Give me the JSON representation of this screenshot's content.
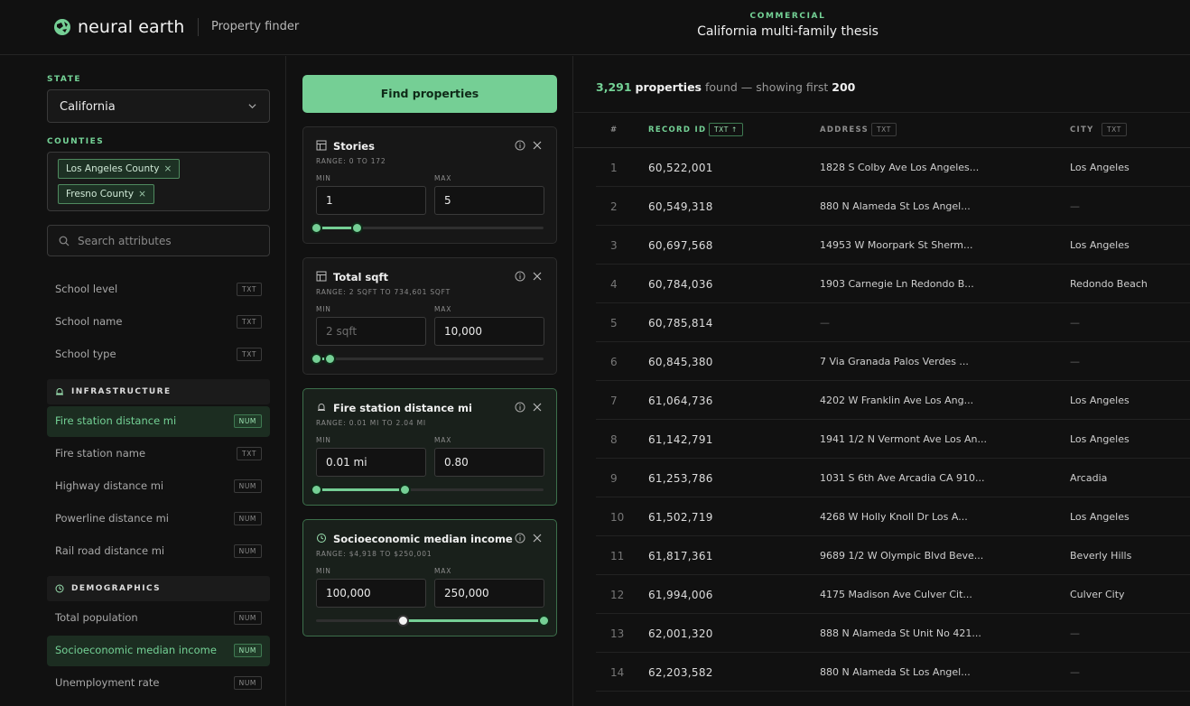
{
  "header": {
    "brand": "neural earth",
    "subtitle": "Property finder",
    "kicker": "COMMERCIAL",
    "title": "California multi-family thesis"
  },
  "sidebar": {
    "state_label": "STATE",
    "state_value": "California",
    "counties_label": "COUNTIES",
    "counties": [
      "Los Angeles County",
      "Fresno County"
    ],
    "search_placeholder": "Search attributes",
    "attributes_top": [
      {
        "name": "School level",
        "type": "TXT"
      },
      {
        "name": "School name",
        "type": "TXT"
      },
      {
        "name": "School type",
        "type": "TXT"
      }
    ],
    "infrastructure": {
      "label": "INFRASTRUCTURE",
      "items": [
        {
          "name": "Fire station distance mi",
          "type": "NUM",
          "active": true
        },
        {
          "name": "Fire station name",
          "type": "TXT"
        },
        {
          "name": "Highway distance mi",
          "type": "NUM"
        },
        {
          "name": "Powerline distance mi",
          "type": "NUM"
        },
        {
          "name": "Rail road distance mi",
          "type": "NUM"
        }
      ]
    },
    "demographics": {
      "label": "DEMOGRAPHICS",
      "items": [
        {
          "name": "Total population",
          "type": "NUM"
        },
        {
          "name": "Socioeconomic median income",
          "type": "NUM",
          "active": true
        },
        {
          "name": "Unemployment rate",
          "type": "NUM"
        }
      ]
    }
  },
  "filters": {
    "find_label": "Find properties",
    "min_label": "MIN",
    "max_label": "MAX",
    "cards": [
      {
        "title": "Stories",
        "range": "RANGE: 0 TO 172",
        "min": "1",
        "max": "5",
        "min_placeholder": false,
        "slider_from": 0,
        "slider_to": 0.18,
        "active": false,
        "icon": "table-icon"
      },
      {
        "title": "Total sqft",
        "range": "RANGE: 2 SQFT TO 734,601 SQFT",
        "min": "2 sqft",
        "max": "10,000",
        "min_placeholder": true,
        "slider_from": 0,
        "slider_to": 0.06,
        "active": false,
        "icon": "table-icon"
      },
      {
        "title": "Fire station distance mi",
        "range": "RANGE: 0.01 MI TO 2.04 MI",
        "min": "0.01 mi",
        "max": "0.80",
        "min_placeholder": false,
        "slider_from": 0,
        "slider_to": 0.39,
        "active": true,
        "icon": "bell-icon"
      },
      {
        "title": "Socioeconomic median income",
        "range": "RANGE: $4,918 TO $250,001",
        "min": "100,000",
        "max": "250,000",
        "min_placeholder": false,
        "slider_from": 0.38,
        "slider_to": 1,
        "active": true,
        "icon": "clock-icon"
      }
    ]
  },
  "results": {
    "count": "3,291",
    "count_suffix": "properties",
    "found_text": "found — showing first",
    "shown": "200",
    "columns": {
      "index": "#",
      "record_id": "RECORD ID",
      "record_tag": "TXT ↑",
      "address": "ADDRESS",
      "address_tag": "TXT",
      "city": "CITY",
      "city_tag": "TXT"
    },
    "rows": [
      {
        "i": "1",
        "id": "60,522,001",
        "addr": "1828 S Colby Ave Los Angeles...",
        "city": "Los Angeles"
      },
      {
        "i": "2",
        "id": "60,549,318",
        "addr": "880 N Alameda St Los Angel...",
        "city": "—"
      },
      {
        "i": "3",
        "id": "60,697,568",
        "addr": "14953 W Moorpark St Sherm...",
        "city": "Los Angeles"
      },
      {
        "i": "4",
        "id": "60,784,036",
        "addr": "1903 Carnegie Ln Redondo B...",
        "city": "Redondo Beach"
      },
      {
        "i": "5",
        "id": "60,785,814",
        "addr": "—",
        "city": "—"
      },
      {
        "i": "6",
        "id": "60,845,380",
        "addr": "7 Via Granada Palos Verdes ...",
        "city": "—"
      },
      {
        "i": "7",
        "id": "61,064,736",
        "addr": "4202 W Franklin Ave Los Ang...",
        "city": "Los Angeles"
      },
      {
        "i": "8",
        "id": "61,142,791",
        "addr": "1941 1/2 N Vermont Ave Los An...",
        "city": "Los Angeles"
      },
      {
        "i": "9",
        "id": "61,253,786",
        "addr": "1031 S 6th Ave Arcadia CA 910...",
        "city": "Arcadia"
      },
      {
        "i": "10",
        "id": "61,502,719",
        "addr": "4268 W Holly Knoll Dr Los A...",
        "city": "Los Angeles"
      },
      {
        "i": "11",
        "id": "61,817,361",
        "addr": "9689 1/2 W Olympic Blvd Beve...",
        "city": "Beverly Hills"
      },
      {
        "i": "12",
        "id": "61,994,006",
        "addr": "4175 Madison Ave Culver Cit...",
        "city": "Culver City"
      },
      {
        "i": "13",
        "id": "62,001,320",
        "addr": "888 N Alameda St Unit No 421...",
        "city": "—"
      },
      {
        "i": "14",
        "id": "62,203,582",
        "addr": "880 N Alameda St Los Angel...",
        "city": "—"
      }
    ]
  },
  "colors": {
    "accent": "#75cf95",
    "background": "#111111",
    "panel": "#171717"
  }
}
